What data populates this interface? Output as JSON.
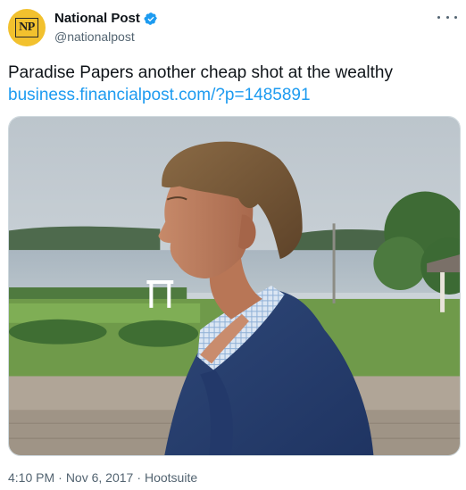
{
  "author": {
    "display_name": "National Post",
    "handle": "@nationalpost",
    "avatar_logo": "NP",
    "verified": true,
    "avatar_color": "#f2c12e"
  },
  "tweet": {
    "text": "Paradise Papers another cheap shot at the wealthy",
    "link": "business.financialpost.com/?p=1485891"
  },
  "meta": {
    "time": "4:10 PM",
    "separator1": "·",
    "date": "Nov 6, 2017",
    "separator2": "·",
    "source": "Hootsuite"
  },
  "icons": {
    "verified": "verified-badge-icon",
    "more": "more-options-icon"
  },
  "colors": {
    "link": "#1d9bf0",
    "secondary_text": "#536471",
    "verified": "#1d9bf0"
  }
}
